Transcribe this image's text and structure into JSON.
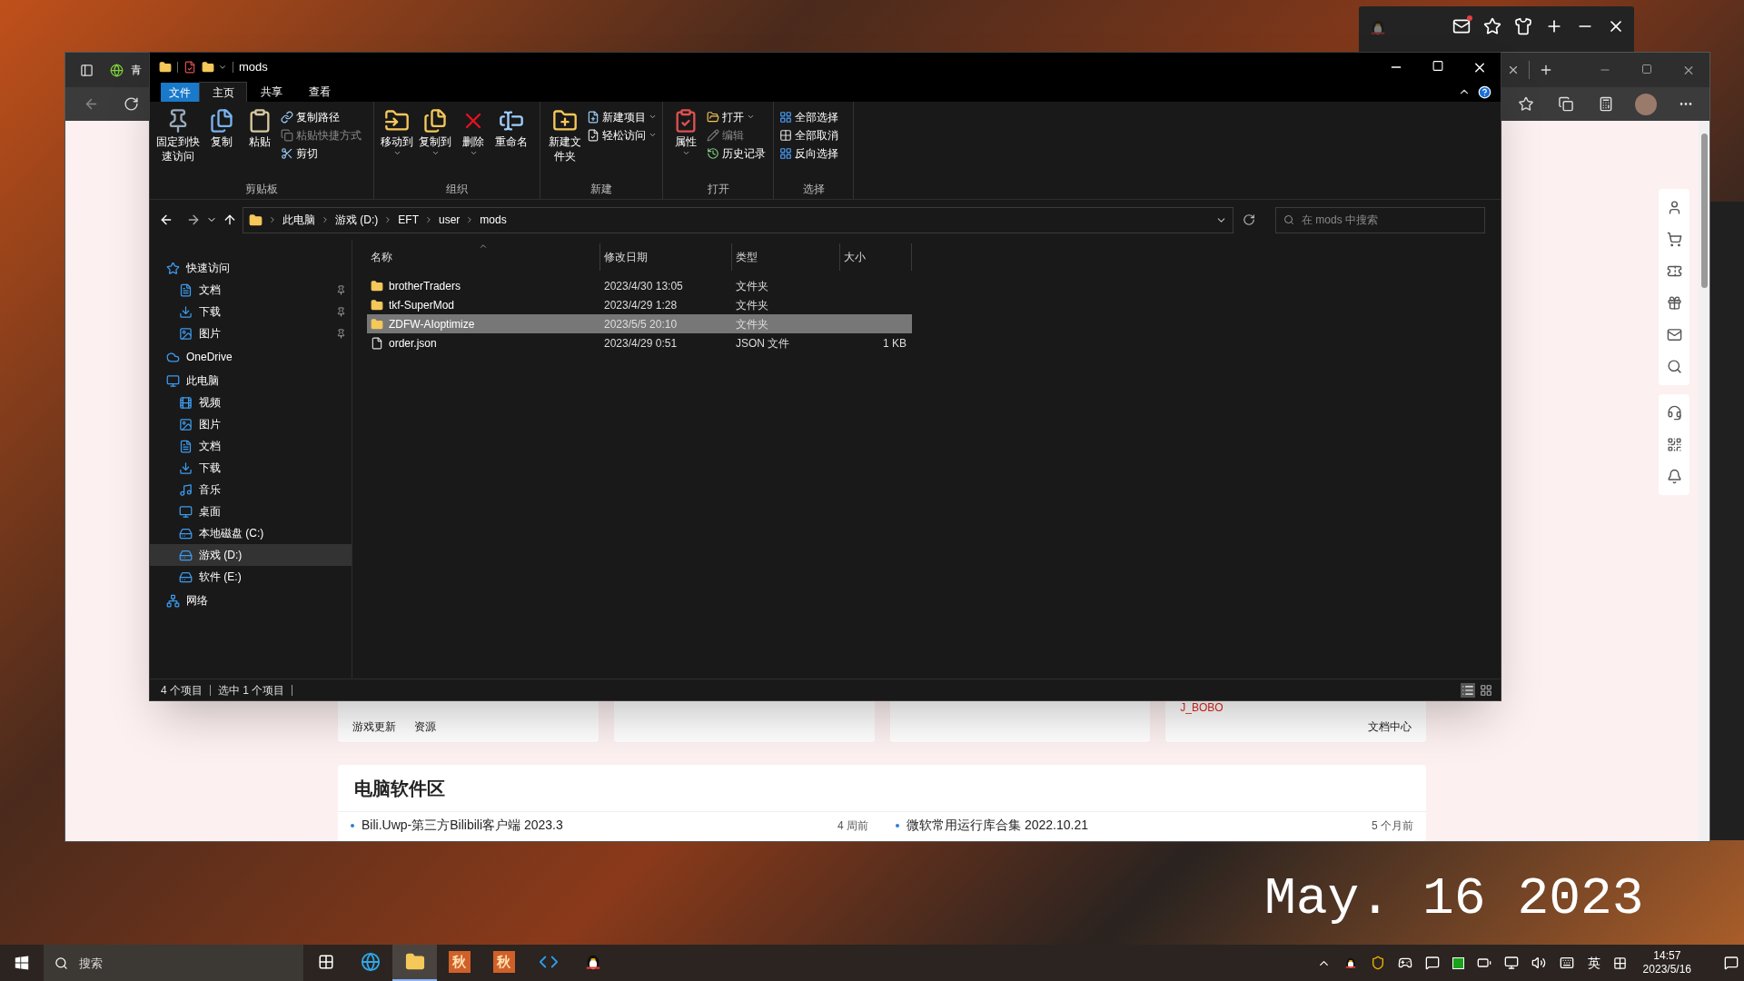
{
  "browser": {
    "tab_title": "青",
    "shortcuts": [
      "游戏更新",
      "资源"
    ],
    "user_name": "J_BOBO",
    "docs_link": "文档中心",
    "section": {
      "title": "电脑软件区",
      "items": [
        {
          "title": "Bili.Uwp-第三方Bilibili客户端 2023.3",
          "time": "4 周前"
        },
        {
          "title": "微软常用运行库合集 2022.10.21",
          "time": "5 个月前"
        }
      ]
    }
  },
  "explorer": {
    "title": "mods",
    "ribbon": {
      "tabs": [
        {
          "label": "文件",
          "kind": "menu",
          "selected": false
        },
        {
          "label": "主页",
          "kind": "tab",
          "selected": true
        },
        {
          "label": "共享",
          "kind": "tab",
          "selected": false
        },
        {
          "label": "查看",
          "kind": "tab",
          "selected": false
        }
      ],
      "groups": [
        {
          "label": "剪贴板",
          "items": [
            {
              "kind": "large",
              "label": "固定到快速访问",
              "dropdown": false
            },
            {
              "kind": "large",
              "label": "复制",
              "dropdown": false
            },
            {
              "kind": "large",
              "label": "粘贴",
              "dropdown": false
            },
            {
              "kind": "stack",
              "items": [
                {
                  "label": "复制路径",
                  "disabled": false,
                  "dropdown": false
                },
                {
                  "label": "粘贴快捷方式",
                  "disabled": true,
                  "dropdown": false
                },
                {
                  "label": "剪切",
                  "disabled": false,
                  "dropdown": false
                }
              ]
            }
          ]
        },
        {
          "label": "组织",
          "items": [
            {
              "kind": "large",
              "label": "移动到",
              "dropdown": true
            },
            {
              "kind": "large",
              "label": "复制到",
              "dropdown": true
            },
            {
              "kind": "large",
              "label": "删除",
              "dropdown": true
            },
            {
              "kind": "large",
              "label": "重命名",
              "dropdown": false
            }
          ]
        },
        {
          "label": "新建",
          "items": [
            {
              "kind": "large",
              "label": "新建文件夹",
              "dropdown": false
            },
            {
              "kind": "stack",
              "items": [
                {
                  "label": "新建项目",
                  "disabled": false,
                  "dropdown": true
                },
                {
                  "label": "轻松访问",
                  "disabled": false,
                  "dropdown": true
                }
              ]
            }
          ]
        },
        {
          "label": "打开",
          "items": [
            {
              "kind": "large",
              "label": "属性",
              "dropdown": true
            },
            {
              "kind": "stack",
              "items": [
                {
                  "label": "打开",
                  "disabled": false,
                  "dropdown": true
                },
                {
                  "label": "编辑",
                  "disabled": true,
                  "dropdown": false
                },
                {
                  "label": "历史记录",
                  "disabled": false,
                  "dropdown": false
                }
              ]
            }
          ]
        },
        {
          "label": "选择",
          "items": [
            {
              "kind": "stack",
              "items": [
                {
                  "label": "全部选择",
                  "disabled": false,
                  "dropdown": false
                },
                {
                  "label": "全部取消",
                  "disabled": false,
                  "dropdown": false
                },
                {
                  "label": "反向选择",
                  "disabled": false,
                  "dropdown": false
                }
              ]
            }
          ]
        }
      ]
    },
    "address": {
      "segments": [
        "此电脑",
        "游戏 (D:)",
        "EFT",
        "user",
        "mods"
      ],
      "search_placeholder": "在 mods 中搜索"
    },
    "nav": [
      {
        "label": "快速访问",
        "selected": false,
        "children": [
          {
            "label": "文档",
            "pinned": true,
            "selected": false
          },
          {
            "label": "下载",
            "pinned": true,
            "selected": false
          },
          {
            "label": "图片",
            "pinned": true,
            "selected": false
          }
        ]
      },
      {
        "label": "OneDrive",
        "selected": false
      },
      {
        "label": "此电脑",
        "selected": false,
        "children": [
          {
            "label": "视频",
            "selected": false
          },
          {
            "label": "图片",
            "selected": false
          },
          {
            "label": "文档",
            "selected": false
          },
          {
            "label": "下载",
            "selected": false
          },
          {
            "label": "音乐",
            "selected": false
          },
          {
            "label": "桌面",
            "selected": false
          },
          {
            "label": "本地磁盘 (C:)",
            "selected": false
          },
          {
            "label": "游戏 (D:)",
            "selected": true
          },
          {
            "label": "软件 (E:)",
            "selected": false
          }
        ]
      },
      {
        "label": "网络",
        "selected": false
      }
    ],
    "columns": [
      {
        "label": "名称",
        "sorted": true
      },
      {
        "label": "修改日期",
        "sorted": false
      },
      {
        "label": "类型",
        "sorted": false
      },
      {
        "label": "大小",
        "sorted": false
      }
    ],
    "rows": [
      {
        "name": "brotherTraders",
        "modified": "2023/4/30 13:05",
        "type": "文件夹",
        "kind": "folder",
        "selected": false
      },
      {
        "name": "tkf-SuperMod",
        "modified": "2023/4/29 1:28",
        "type": "文件夹",
        "kind": "folder",
        "selected": false
      },
      {
        "name": "ZDFW-AIoptimize",
        "modified": "2023/5/5 20:10",
        "type": "文件夹",
        "kind": "folder",
        "selected": true
      },
      {
        "name": "order.json",
        "modified": "2023/4/29 0:51",
        "type": "JSON 文件",
        "size": "1 KB",
        "kind": "file",
        "selected": false
      }
    ],
    "status": {
      "item_count": "4 个项目",
      "selection": "选中 1 个项目",
      "view_modes": [
        {
          "selected": true
        },
        {
          "selected": false
        }
      ]
    }
  },
  "desktop": {
    "clock": "May. 16 2023"
  },
  "taskbar": {
    "search_placeholder": "搜索",
    "apps": [
      {
        "kind": "task-view",
        "active": false
      },
      {
        "kind": "browser",
        "active": false
      },
      {
        "kind": "explorer",
        "active": true
      },
      {
        "kind": "glyph",
        "label": "秋",
        "active": false
      },
      {
        "kind": "glyph",
        "label": "秋",
        "active": false
      },
      {
        "kind": "code",
        "active": false
      },
      {
        "kind": "penguin",
        "active": false
      }
    ],
    "ime": "英",
    "time": "14:57",
    "date": "2023/5/16"
  }
}
